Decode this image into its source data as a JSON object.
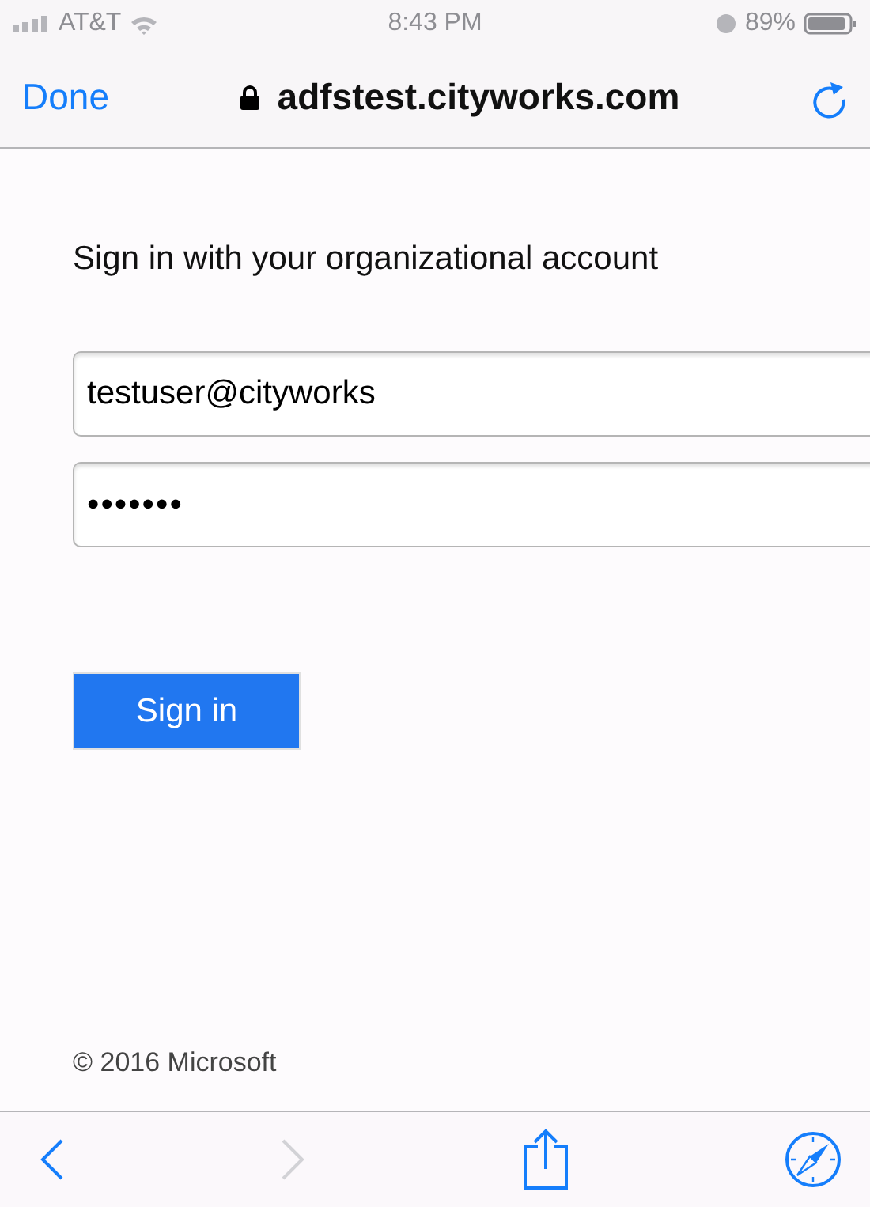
{
  "status_bar": {
    "carrier": "AT&T",
    "time": "8:43 PM",
    "battery": "89%"
  },
  "nav_bar": {
    "done": "Done",
    "url": "adfstest.cityworks.com"
  },
  "form": {
    "heading": "Sign in with your organizational account",
    "username": {
      "value": "testuser@cityworks"
    },
    "password": {
      "value": "•••••••"
    },
    "submit": "Sign in"
  },
  "footer": "© 2016 Microsoft",
  "toolbar": {
    "back": {
      "disabled": false
    },
    "forward": {
      "disabled": true
    }
  }
}
